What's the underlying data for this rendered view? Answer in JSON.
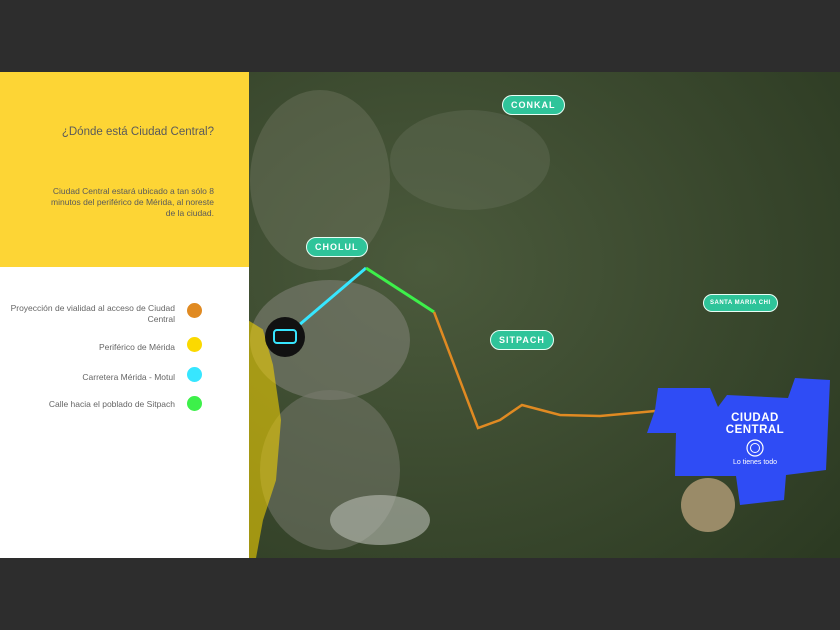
{
  "panel": {
    "title": "¿Dónde está Ciudad Central?",
    "description": "Ciudad Central estará ubicado a tan sólo 8 minutos del periférico de Mérida, al noreste de la ciudad."
  },
  "legend": [
    {
      "label": "Proyección de vialidad al acceso de Ciudad Central",
      "color": "#e08a22"
    },
    {
      "label": "Periférico de Mérida",
      "color": "#fbd900"
    },
    {
      "label": "Carretera Mérida - Motul",
      "color": "#37e6ff"
    },
    {
      "label": "Calle hacia el poblado de Sitpach",
      "color": "#3df04a"
    }
  ],
  "map": {
    "labels": {
      "conkal": "CONKAL",
      "cholul": "CHOLUL",
      "sitpach": "SITPACH",
      "santa_maria": "SANTA MARIA CHI"
    },
    "development": {
      "name": "CIUDAD CENTRAL",
      "tagline": "Lo tienes todo",
      "color": "#2f4cf5"
    }
  }
}
